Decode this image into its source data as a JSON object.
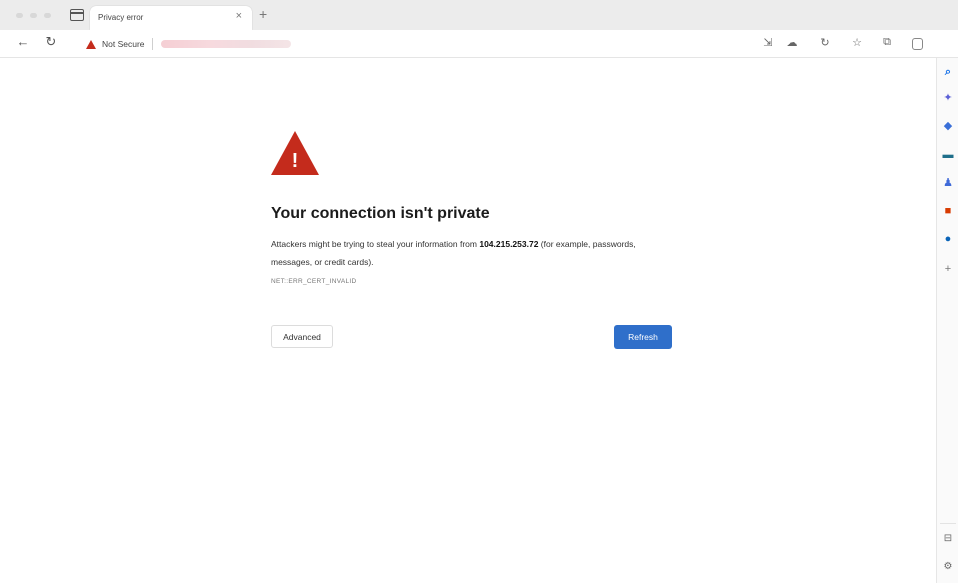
{
  "browser": {
    "tab": {
      "title": "Privacy error",
      "close_glyph": "×"
    },
    "new_tab_glyph": "+",
    "address_bar": {
      "security_label": "Not Secure",
      "url_redacted": true
    },
    "toolbar_icons": [
      "read-aloud-icon",
      "extensions-icon",
      "refresh-icon",
      "favorites-icon",
      "collections-icon",
      "profile-icon"
    ],
    "menu_glyph": "···"
  },
  "page": {
    "heading": "Your connection isn't private",
    "desc_before": "Attackers might be trying to steal your information from ",
    "desc_host": "104.215.253.72",
    "desc_after": " (for example, passwords, messages, or credit cards).",
    "error_code": "NET::ERR_CERT_INVALID",
    "advanced_label": "Advanced",
    "refresh_label": "Refresh",
    "accent_color": "#2f6fca",
    "warning_color": "#c42b1c"
  },
  "sidebar": {
    "items": [
      {
        "name": "search-icon",
        "glyph": "🔍",
        "color": "#1a73e8"
      },
      {
        "name": "copilot-icon",
        "glyph": "✦",
        "color": "#5b5fd6"
      },
      {
        "name": "shopping-icon",
        "glyph": "◆",
        "color": "#3a6fd8"
      },
      {
        "name": "tools-icon",
        "glyph": "▬",
        "color": "#1f6f8b"
      },
      {
        "name": "games-icon",
        "glyph": "♟",
        "color": "#3f6ad8"
      },
      {
        "name": "office-icon",
        "glyph": "■",
        "color": "#d83b01"
      },
      {
        "name": "outlook-icon",
        "glyph": "●",
        "color": "#0a64b8"
      }
    ],
    "add_glyph": "+",
    "bottom": [
      "sidebar-toggle-icon",
      "settings-icon"
    ]
  }
}
